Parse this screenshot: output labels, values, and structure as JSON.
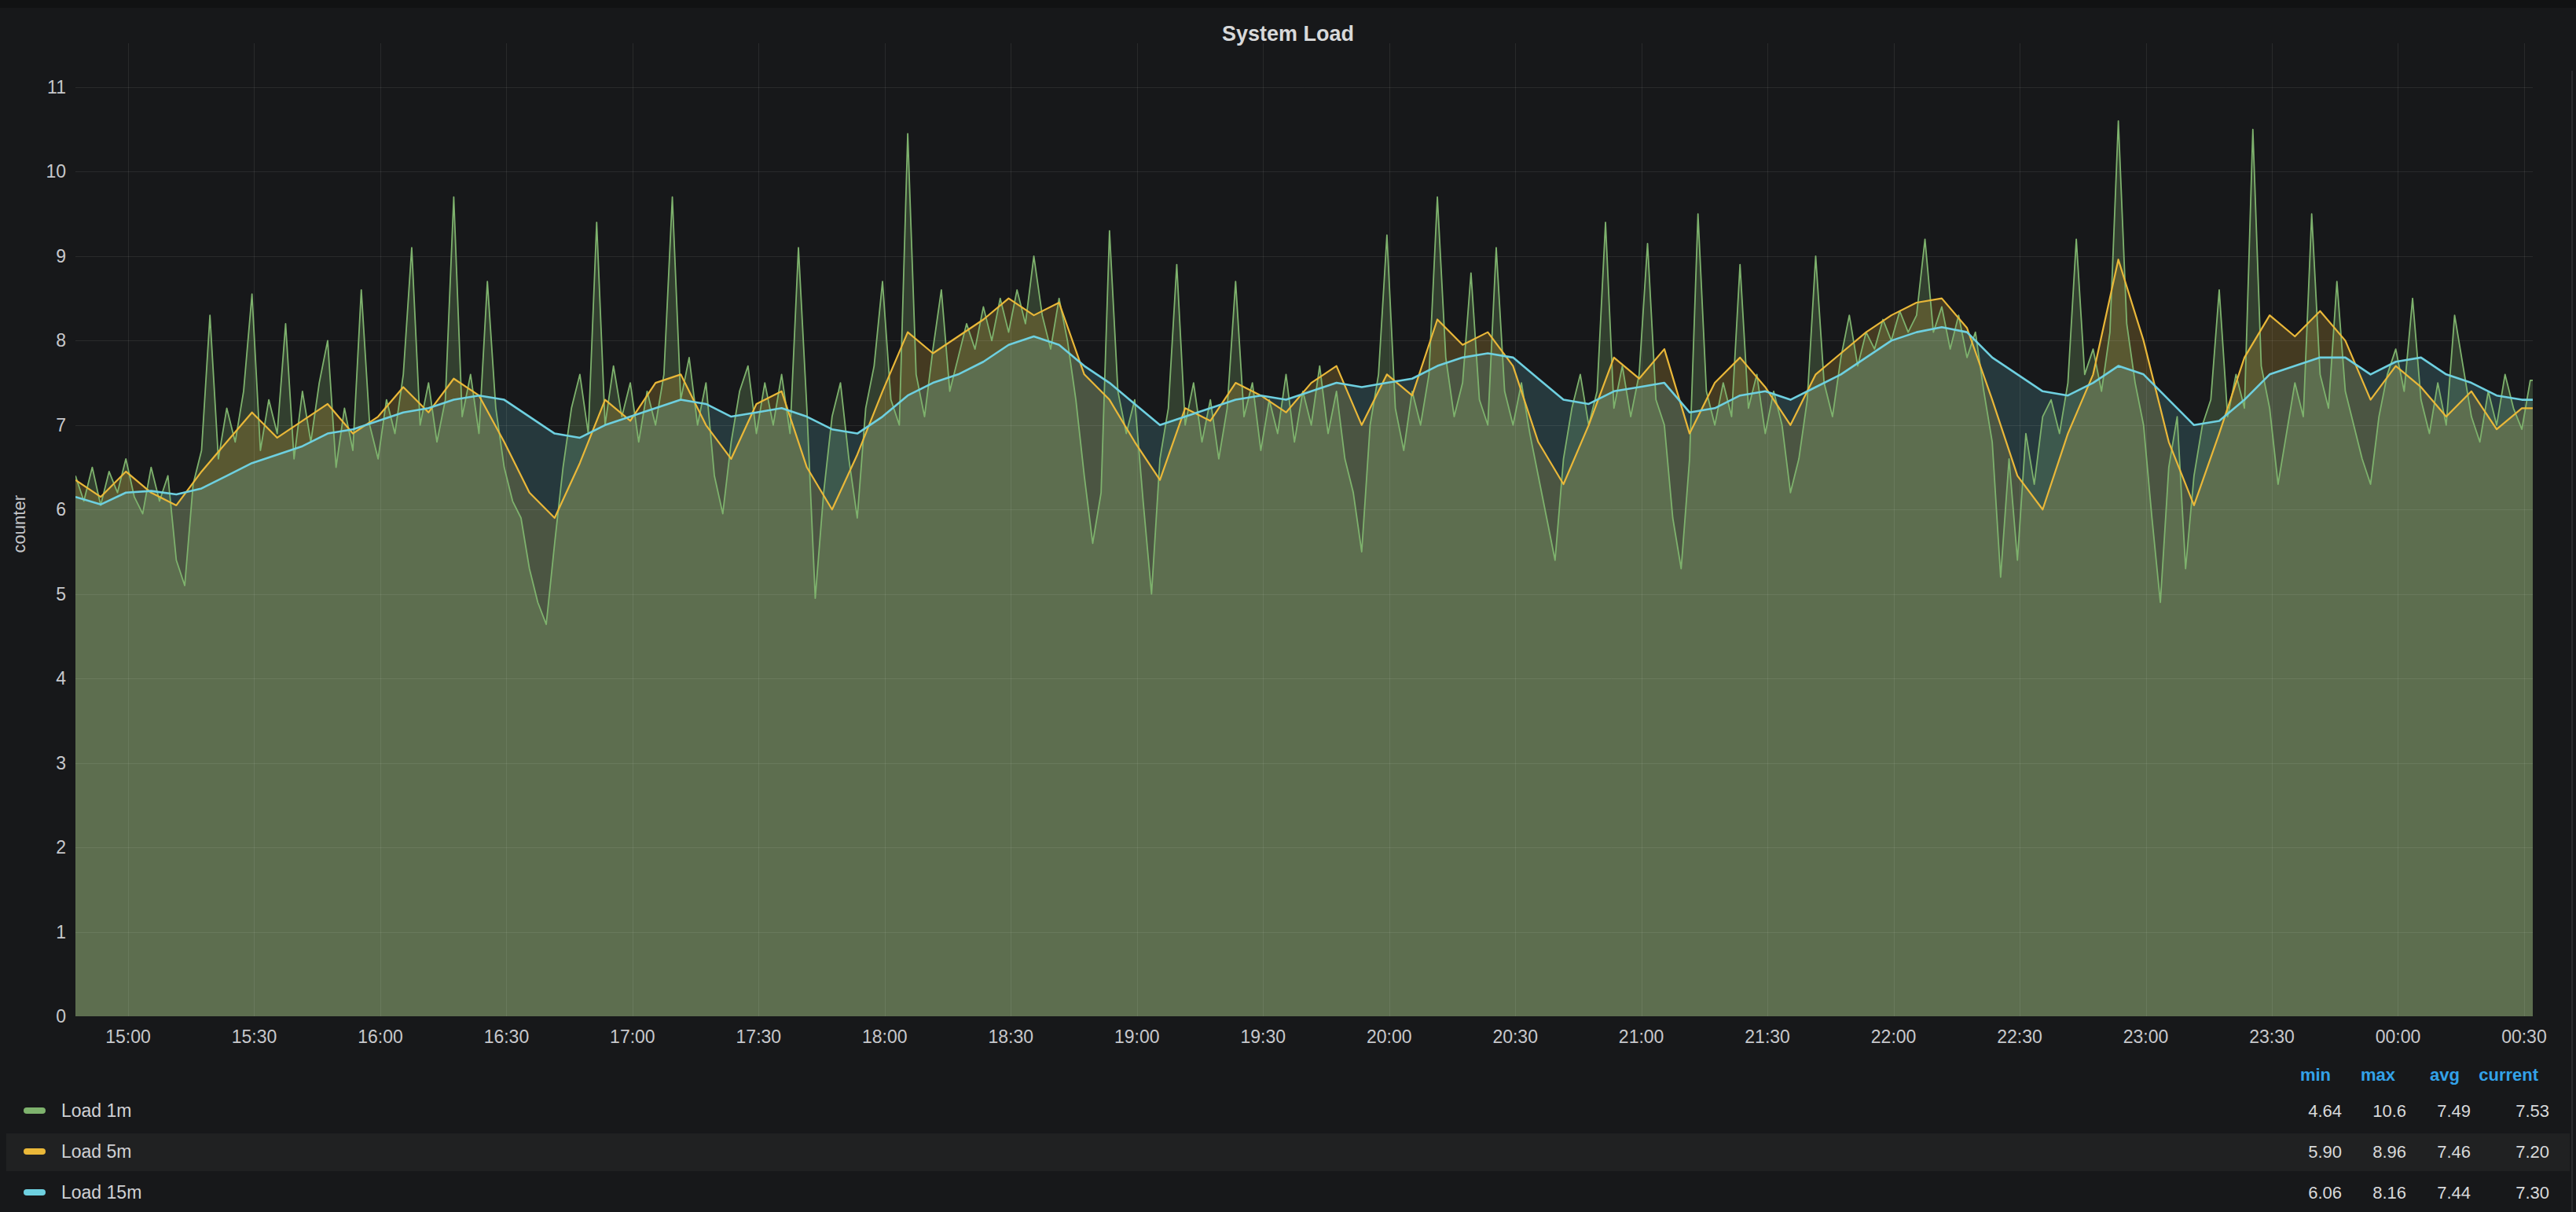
{
  "title": "System Load",
  "y_axis": {
    "label": "counter",
    "ticks": [
      0,
      1,
      2,
      3,
      4,
      5,
      6,
      7,
      8,
      9,
      10,
      11
    ]
  },
  "x_axis": {
    "ticks": [
      "15:00",
      "15:30",
      "16:00",
      "16:30",
      "17:00",
      "17:30",
      "18:00",
      "18:30",
      "19:00",
      "19:30",
      "20:00",
      "20:30",
      "21:00",
      "21:30",
      "22:00",
      "22:30",
      "23:00",
      "23:30",
      "00:00",
      "00:30"
    ]
  },
  "legend": {
    "headers": [
      "min",
      "max",
      "avg",
      "current"
    ],
    "header_color": "#33a2e8",
    "rows": [
      {
        "name": "Load 1m",
        "color": "#7EB26D",
        "min": "4.64",
        "max": "10.6",
        "avg": "7.49",
        "current": "7.53",
        "striped": false
      },
      {
        "name": "Load 5m",
        "color": "#EAB839",
        "min": "5.90",
        "max": "8.96",
        "avg": "7.46",
        "current": "7.20",
        "striped": true
      },
      {
        "name": "Load 15m",
        "color": "#6ED0E0",
        "min": "6.06",
        "max": "8.16",
        "avg": "7.44",
        "current": "7.30",
        "striped": false
      }
    ]
  },
  "chart_data": {
    "type": "area",
    "title": "System Load",
    "ylabel": "counter",
    "ylim": [
      0,
      11
    ],
    "grid": true,
    "legend_position": "bottom",
    "x_unit": "minutes since 14:48, chart spans 14:48 - 00:32",
    "series": [
      {
        "name": "Load 1m",
        "color": "#7EB26D",
        "fill_alpha": 0.26,
        "step_min": 2,
        "stats": {
          "min": 4.64,
          "max": 10.6,
          "avg": 7.49,
          "current": 7.53
        },
        "values": [
          6.4,
          6.1,
          6.5,
          6.05,
          6.45,
          6.2,
          6.6,
          6.15,
          5.95,
          6.5,
          6.1,
          6.4,
          5.4,
          5.1,
          6.3,
          6.7,
          8.3,
          6.6,
          7.2,
          6.8,
          7.4,
          8.55,
          6.7,
          7.3,
          6.9,
          8.2,
          6.6,
          7.4,
          6.8,
          7.5,
          8.0,
          6.5,
          7.2,
          6.7,
          8.6,
          7.0,
          6.6,
          7.3,
          6.9,
          7.6,
          9.1,
          7.0,
          7.5,
          6.8,
          7.3,
          9.7,
          7.1,
          7.6,
          6.9,
          8.7,
          7.2,
          6.5,
          6.1,
          5.9,
          5.3,
          4.9,
          4.64,
          5.6,
          6.5,
          7.2,
          7.6,
          6.9,
          9.4,
          7.0,
          7.7,
          7.1,
          7.5,
          6.8,
          7.4,
          7.0,
          7.6,
          9.7,
          7.3,
          7.8,
          7.0,
          7.5,
          6.4,
          5.95,
          6.8,
          7.4,
          7.7,
          6.9,
          7.5,
          7.0,
          7.6,
          6.9,
          9.1,
          7.2,
          4.95,
          6.2,
          7.1,
          7.5,
          6.6,
          5.9,
          7.2,
          7.7,
          8.7,
          7.3,
          7.0,
          10.45,
          7.6,
          7.1,
          7.9,
          8.6,
          7.4,
          7.8,
          8.2,
          7.9,
          8.4,
          8.0,
          8.5,
          8.1,
          8.6,
          8.2,
          9.0,
          8.3,
          7.9,
          8.5,
          8.0,
          7.3,
          6.4,
          5.6,
          6.2,
          9.3,
          7.4,
          6.9,
          7.3,
          6.1,
          5.0,
          6.6,
          7.2,
          8.9,
          7.0,
          7.5,
          6.8,
          7.3,
          6.6,
          7.2,
          8.7,
          7.1,
          7.5,
          6.7,
          7.3,
          6.9,
          7.6,
          6.8,
          7.4,
          7.0,
          7.7,
          6.9,
          7.4,
          6.6,
          6.2,
          5.5,
          7.0,
          7.6,
          9.25,
          7.2,
          6.7,
          7.4,
          7.0,
          7.6,
          9.7,
          7.8,
          7.1,
          7.5,
          8.8,
          7.3,
          7.0,
          9.1,
          7.4,
          7.0,
          7.5,
          6.9,
          6.4,
          5.9,
          5.4,
          6.6,
          7.2,
          7.6,
          7.0,
          7.4,
          9.4,
          7.2,
          7.7,
          7.1,
          7.6,
          9.15,
          7.3,
          7.0,
          5.9,
          5.3,
          6.6,
          9.5,
          7.4,
          7.0,
          7.5,
          7.1,
          8.9,
          7.2,
          7.6,
          6.9,
          7.4,
          7.0,
          6.2,
          6.6,
          7.3,
          9.0,
          7.5,
          7.1,
          7.8,
          8.3,
          7.7,
          8.1,
          7.9,
          8.25,
          8.0,
          8.35,
          8.1,
          8.3,
          9.2,
          8.1,
          8.4,
          7.9,
          8.3,
          7.8,
          8.1,
          7.4,
          6.8,
          5.2,
          6.6,
          5.4,
          6.9,
          6.3,
          7.1,
          7.3,
          6.9,
          7.5,
          9.2,
          7.6,
          7.9,
          7.4,
          8.1,
          10.6,
          8.2,
          7.5,
          7.0,
          5.9,
          4.9,
          6.5,
          7.1,
          5.3,
          6.4,
          7.0,
          7.3,
          8.6,
          7.1,
          7.6,
          7.2,
          10.5,
          7.7,
          7.2,
          6.3,
          6.9,
          7.5,
          7.1,
          9.5,
          7.6,
          7.2,
          8.7,
          7.4,
          7.0,
          6.6,
          6.3,
          7.1,
          7.6,
          7.9,
          7.4,
          8.5,
          7.3,
          6.9,
          7.5,
          7.0,
          8.3,
          7.7,
          7.1,
          6.8,
          7.4,
          7.0,
          7.6,
          7.2,
          6.95,
          7.53
        ]
      },
      {
        "name": "Load 5m",
        "color": "#EAB839",
        "fill_alpha": 0.22,
        "step_min": 6,
        "stats": {
          "min": 5.9,
          "max": 8.96,
          "avg": 7.46,
          "current": 7.2
        },
        "values": [
          6.35,
          6.15,
          6.45,
          6.2,
          6.05,
          6.45,
          6.8,
          7.15,
          6.85,
          7.05,
          7.25,
          6.9,
          7.1,
          7.45,
          7.15,
          7.55,
          7.35,
          6.8,
          6.2,
          5.9,
          6.55,
          7.3,
          7.05,
          7.5,
          7.6,
          7.0,
          6.6,
          7.25,
          7.4,
          6.5,
          6.0,
          6.65,
          7.4,
          8.1,
          7.85,
          8.05,
          8.25,
          8.5,
          8.3,
          8.45,
          7.6,
          7.3,
          6.8,
          6.35,
          7.2,
          7.05,
          7.5,
          7.35,
          7.15,
          7.5,
          7.7,
          7.0,
          7.6,
          7.35,
          8.25,
          7.95,
          8.1,
          7.7,
          6.8,
          6.3,
          7.0,
          7.8,
          7.55,
          7.9,
          6.9,
          7.5,
          7.8,
          7.45,
          7.0,
          7.6,
          7.85,
          8.1,
          8.3,
          8.45,
          8.5,
          8.15,
          7.3,
          6.4,
          6.0,
          6.9,
          7.6,
          8.96,
          8.0,
          6.8,
          6.05,
          6.9,
          7.8,
          8.3,
          8.05,
          8.35,
          8.0,
          7.3,
          7.7,
          7.45,
          7.1,
          7.4,
          6.95,
          7.2
        ]
      },
      {
        "name": "Load 15m",
        "color": "#6ED0E0",
        "fill_alpha": 0.18,
        "step_min": 6,
        "stats": {
          "min": 6.06,
          "max": 8.16,
          "avg": 7.44,
          "current": 7.3
        },
        "values": [
          6.15,
          6.06,
          6.2,
          6.22,
          6.18,
          6.25,
          6.4,
          6.55,
          6.65,
          6.75,
          6.9,
          6.95,
          7.05,
          7.15,
          7.2,
          7.3,
          7.35,
          7.3,
          7.1,
          6.9,
          6.85,
          7.0,
          7.1,
          7.2,
          7.3,
          7.25,
          7.1,
          7.15,
          7.2,
          7.1,
          6.95,
          6.9,
          7.1,
          7.35,
          7.5,
          7.6,
          7.75,
          7.95,
          8.05,
          7.95,
          7.7,
          7.5,
          7.25,
          7.0,
          7.1,
          7.2,
          7.3,
          7.35,
          7.3,
          7.4,
          7.5,
          7.45,
          7.5,
          7.55,
          7.7,
          7.8,
          7.85,
          7.8,
          7.55,
          7.3,
          7.25,
          7.4,
          7.45,
          7.5,
          7.15,
          7.2,
          7.35,
          7.4,
          7.3,
          7.45,
          7.6,
          7.8,
          8.0,
          8.1,
          8.16,
          8.1,
          7.8,
          7.6,
          7.4,
          7.35,
          7.5,
          7.7,
          7.6,
          7.3,
          7.0,
          7.05,
          7.3,
          7.6,
          7.7,
          7.8,
          7.8,
          7.6,
          7.75,
          7.8,
          7.6,
          7.5,
          7.35,
          7.3
        ]
      }
    ]
  }
}
